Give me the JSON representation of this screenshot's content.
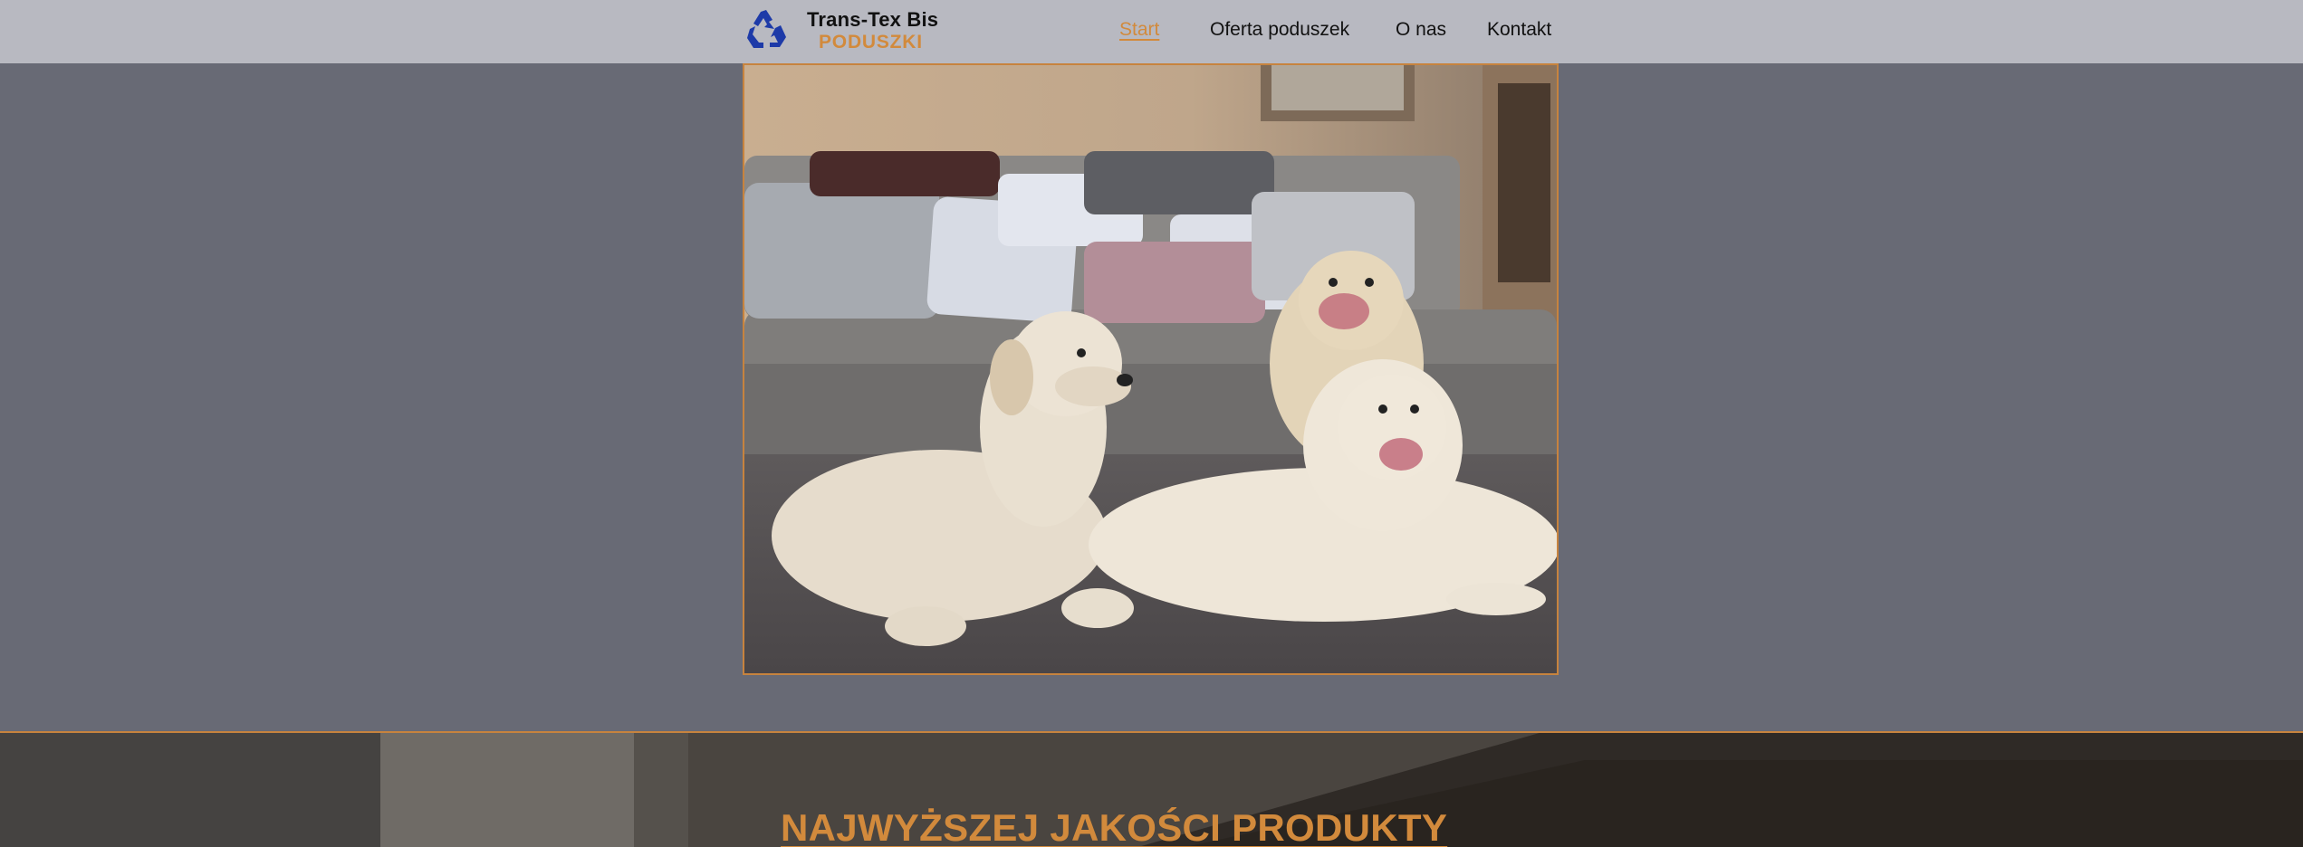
{
  "brand": {
    "name": "Trans-Tex Bis",
    "subtitle": "PODUSZKI",
    "logo_icon": "recycle-icon",
    "logo_color": "#1d3aa8"
  },
  "nav": {
    "items": [
      {
        "label": "Start",
        "active": true
      },
      {
        "label": "Oferta poduszek",
        "active": false
      },
      {
        "label": "O nas",
        "active": false
      },
      {
        "label": "Kontakt",
        "active": false
      }
    ]
  },
  "hero": {
    "image": "photo-three-golden-retrievers-on-sofa-with-pillows"
  },
  "section2": {
    "title": "NAJWYŻSZEJ JAKOŚCI PRODUKTY"
  },
  "colors": {
    "accent": "#d28a3c",
    "header_bg": "#b8b9c1",
    "page_bg": "#686a75"
  }
}
